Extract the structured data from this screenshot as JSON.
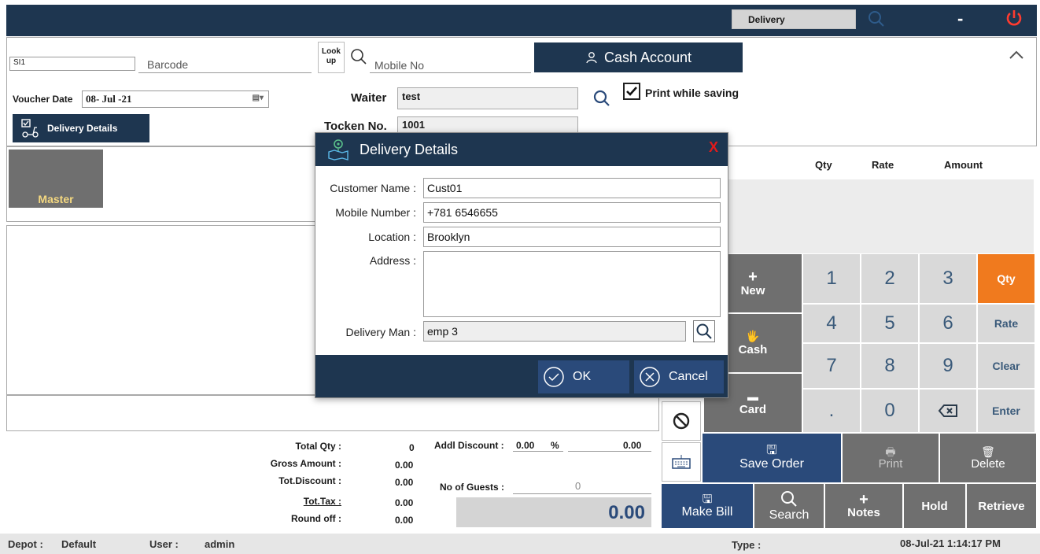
{
  "topbar": {
    "order_type": "Delivery",
    "minimize_label": "-"
  },
  "header": {
    "series_value": "SI1",
    "barcode_label": "Barcode",
    "lookup_label_1": "Look",
    "lookup_label_2": "up",
    "mobile_label": "Mobile No",
    "cash_account_label": "Cash Account",
    "voucher_date_label": "Voucher Date",
    "voucher_date_value": "08- Jul -21",
    "waiter_label": "Waiter",
    "waiter_value": "test",
    "print_while_saving_label": "Print while saving",
    "print_while_saving_checked": true,
    "token_label": "Tocken No.",
    "token_value": "1001",
    "delivery_details_label": "Delivery Details"
  },
  "master": {
    "tile_label": "Master"
  },
  "grid": {
    "columns": [
      "Qty",
      "Rate",
      "Amount"
    ]
  },
  "keypad": {
    "new_label": "New",
    "cash_label": "Cash",
    "card_label": "Card",
    "keys": [
      "1",
      "2",
      "3",
      "4",
      "5",
      "6",
      "7",
      "8",
      "9",
      ".",
      "0"
    ],
    "side_keys": [
      "Qty",
      "Rate",
      "Clear",
      "Enter"
    ],
    "active_side_key": "Qty"
  },
  "actions": {
    "save_order": "Save Order",
    "print": "Print",
    "delete": "Delete",
    "make_bill": "Make Bill",
    "search": "Search",
    "notes": "Notes",
    "hold": "Hold",
    "retrieve": "Retrieve"
  },
  "totals": {
    "total_qty_label": "Total Qty :",
    "total_qty_value": "0",
    "gross_amount_label": "Gross Amount :",
    "gross_amount_value": "0.00",
    "tot_discount_label": "Tot.Discount :",
    "tot_discount_value": "0.00",
    "tot_tax_label": "Tot.Tax :",
    "tot_tax_value": "0.00",
    "round_off_label": "Round off :",
    "round_off_value": "0.00",
    "addl_discount_label": "Addl Discount :",
    "addl_discount_pct": "0.00",
    "pct_symbol": "%",
    "addl_discount_value": "0.00",
    "guests_label": "No of Guests :",
    "guests_value": "0",
    "grand_total": "0.00"
  },
  "status": {
    "depot_label": "Depot :",
    "depot_value": "Default",
    "user_label": "User :",
    "user_value": "admin",
    "type_label": "Type :",
    "datetime": "08-Jul-21 1:14:17 PM"
  },
  "modal": {
    "title": "Delivery Details",
    "close_label": "X",
    "customer_name_label": "Customer Name :",
    "customer_name_value": "Cust01",
    "mobile_label": "Mobile Number :",
    "mobile_value": "+781 6546655",
    "location_label": "Location :",
    "location_value": "Brooklyn",
    "address_label": "Address :",
    "address_value": "",
    "delivery_man_label": "Delivery Man :",
    "delivery_man_value": "emp 3",
    "ok_label": "OK",
    "cancel_label": "Cancel"
  },
  "colors": {
    "navy": "#1e3650",
    "button_blue": "#2a4a7a",
    "accent_orange": "#f07a1e",
    "close_red": "#e01b1b",
    "tile_grey": "#6f6f6f"
  }
}
